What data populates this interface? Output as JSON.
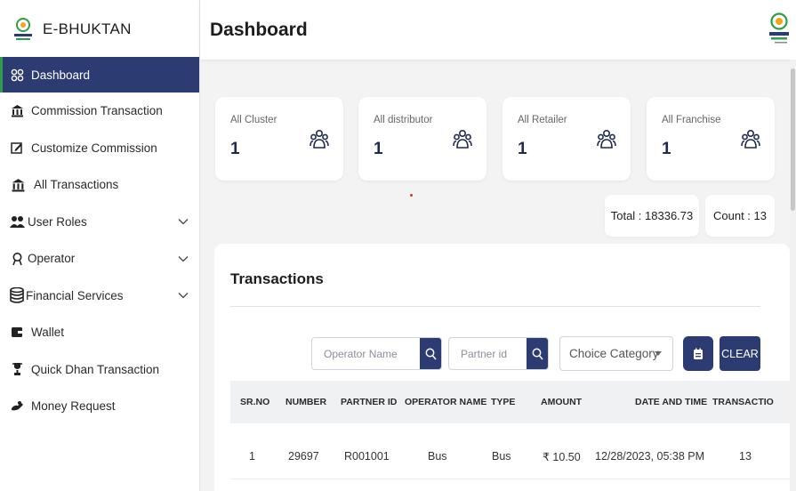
{
  "brand": {
    "name": "E-BHUKTAN"
  },
  "header": {
    "title": "Dashboard"
  },
  "sidebar": {
    "items": [
      {
        "label": "Dashboard",
        "icon": "grid-icon"
      },
      {
        "label": "Commission Transaction",
        "icon": "bank-icon"
      },
      {
        "label": "Customize Commission",
        "icon": "edit-icon"
      },
      {
        "label": "All Transactions",
        "icon": "bank-icon"
      },
      {
        "label": "User Roles",
        "icon": "users-icon"
      },
      {
        "label": "Operator",
        "icon": "operator-icon"
      },
      {
        "label": "Financial Services",
        "icon": "database-icon"
      },
      {
        "label": "Wallet",
        "icon": "wallet-icon"
      },
      {
        "label": "Quick Dhan Transaction",
        "icon": "trophy-icon"
      },
      {
        "label": "Money Request",
        "icon": "money-icon"
      }
    ]
  },
  "stats": [
    {
      "label": "All Cluster",
      "value": "1"
    },
    {
      "label": "All distributor",
      "value": "1"
    },
    {
      "label": "All Retailer",
      "value": "1"
    },
    {
      "label": "All Franchise",
      "value": "1"
    }
  ],
  "summary": {
    "total": "Total : 18336.73",
    "count": "Count : 13"
  },
  "transactions": {
    "title": "Transactions",
    "operator_placeholder": "Operator Name",
    "partner_placeholder": "Partner id",
    "category_value": "Choice Category",
    "clear_label": "CLEAR",
    "columns": [
      "SR.NO",
      "NUMBER",
      "PARTNER ID",
      "OPERATOR NAME",
      "TYPE",
      "AMOUNT",
      "DATE AND TIME",
      "TRANSACTIO"
    ],
    "rows": [
      [
        "1",
        "29697",
        "R001001",
        "Bus",
        "Bus",
        "₹ 10.50",
        "12/28/2023, 05:38 PM",
        "13"
      ]
    ]
  },
  "colors": {
    "primary": "#2d3b73",
    "active_border": "#2e9e4a",
    "background": "#f3f3f4"
  }
}
